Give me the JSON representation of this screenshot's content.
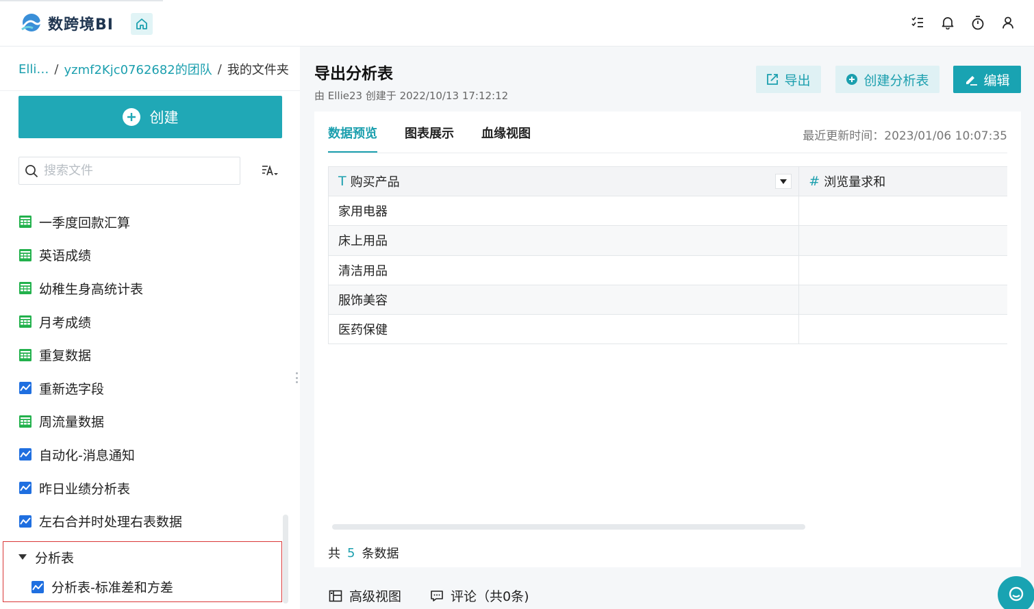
{
  "app": {
    "logo_text": "数跨境BI"
  },
  "breadcrumb": {
    "root": "Elli…",
    "sep": "/",
    "team": "yzmf2Kjc0762682的团队",
    "current": "我的文件夹"
  },
  "sidebar": {
    "create_label": "创建",
    "search_placeholder": "搜索文件",
    "files": [
      {
        "label": "一季度回款汇算",
        "icon": "sheet-icon"
      },
      {
        "label": "英语成绩",
        "icon": "sheet-icon"
      },
      {
        "label": "幼稚生身高统计表",
        "icon": "sheet-icon"
      },
      {
        "label": "月考成绩",
        "icon": "sheet-icon"
      },
      {
        "label": "重复数据",
        "icon": "sheet-icon"
      },
      {
        "label": "重新选字段",
        "icon": "chart-icon"
      },
      {
        "label": "周流量数据",
        "icon": "sheet-icon"
      },
      {
        "label": "自动化-消息通知",
        "icon": "chart-icon"
      },
      {
        "label": "昨日业绩分析表",
        "icon": "chart-icon"
      },
      {
        "label": "左右合并时处理右表数据",
        "icon": "chart-icon"
      }
    ],
    "folder": {
      "label": "分析表",
      "child": "分析表-标准差和方差"
    }
  },
  "page": {
    "title": "导出分析表",
    "meta": "由 Ellie23 创建于 2022/10/13 17:12:12",
    "buttons": {
      "export": "导出",
      "create_sheet": "创建分析表",
      "edit": "编辑"
    },
    "tabs": [
      "数据预览",
      "图表展示",
      "血缘视图"
    ],
    "update_time": "最近更新时间：2023/01/06 10:07:35"
  },
  "table": {
    "columns": [
      {
        "type_glyph": "T",
        "label": "购买产品"
      },
      {
        "type_glyph": "#",
        "label": "浏览量求和"
      }
    ],
    "rows": [
      [
        "家用电器",
        ""
      ],
      [
        "床上用品",
        ""
      ],
      [
        "清洁用品",
        ""
      ],
      [
        "服饰美容",
        ""
      ],
      [
        "医药保健",
        ""
      ]
    ]
  },
  "summary": {
    "prefix": "共",
    "count": "5",
    "suffix": "条数据"
  },
  "bottom": {
    "advanced_view": "高级视图",
    "comments": "评论（共0条)"
  },
  "colors": {
    "accent": "#1b9fae",
    "primary_button": "#20a8b6",
    "highlight_border": "#d93535"
  }
}
